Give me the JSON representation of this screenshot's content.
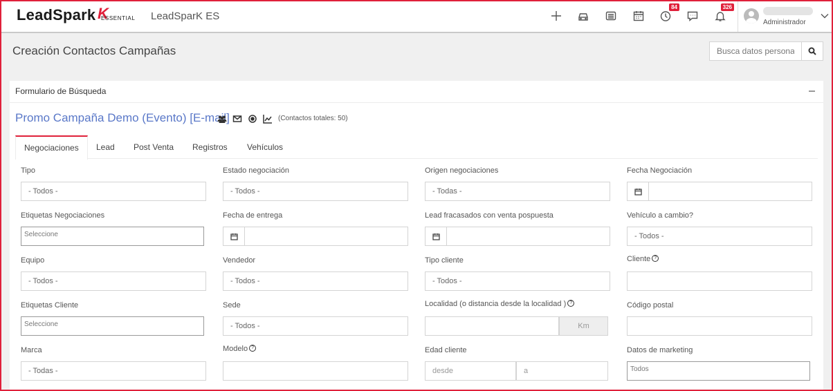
{
  "header": {
    "logo_text": "LeadSpark",
    "logo_sub": "ESSENTIAL",
    "app_name": "LeadSparK ES",
    "icons": [
      "plus-icon",
      "car-icon",
      "inbox-icon",
      "calendar-icon",
      "clock-icon",
      "chat-icon",
      "bell-icon"
    ],
    "clock_badge": "84",
    "bell_badge": "326",
    "user_role": "Administrador"
  },
  "page": {
    "title": "Creación Contactos Campañas",
    "search_placeholder": "Busca datos personale"
  },
  "panel": {
    "title": "Formulario de Búsqueda",
    "campaign_name": "Promo Campaña Demo (Evento) [E-mail]",
    "campaign_icons": [
      "users-icon",
      "envelope-icon",
      "target-icon",
      "chart-line-icon"
    ],
    "contacts_total": "(Contactos totales: 50)"
  },
  "tabs": [
    "Negociaciones",
    "Lead",
    "Post Venta",
    "Registros",
    "Vehículos"
  ],
  "form": {
    "tipo": {
      "label": "Tipo",
      "value": "- Todos -"
    },
    "estado": {
      "label": "Estado negociación",
      "value": "- Todos -"
    },
    "origen": {
      "label": "Origen negociaciones",
      "value": "- Todas -"
    },
    "fecha_neg": {
      "label": "Fecha Negociación",
      "value": ""
    },
    "etiquetas_neg": {
      "label": "Etiquetas Negociaciones",
      "value": "Seleccione"
    },
    "fecha_entrega": {
      "label": "Fecha de entrega",
      "value": ""
    },
    "lead_fracasados": {
      "label": "Lead fracasados con venta pospuesta",
      "value": ""
    },
    "vehiculo_cambio": {
      "label": "Vehículo a cambio?",
      "value": "- Todos -"
    },
    "equipo": {
      "label": "Equipo",
      "value": "- Todos -"
    },
    "vendedor": {
      "label": "Vendedor",
      "value": "- Todos -"
    },
    "tipo_cliente": {
      "label": "Tipo cliente",
      "value": "- Todos -"
    },
    "cliente": {
      "label": "Cliente",
      "value": ""
    },
    "etiquetas_cliente": {
      "label": "Etiquetas Cliente",
      "value": "Seleccione"
    },
    "sede": {
      "label": "Sede",
      "value": "- Todos -"
    },
    "localidad": {
      "label": "Localidad (o distancia desde la localidad )",
      "value": "",
      "addon": "Km"
    },
    "codigo_postal": {
      "label": "Código postal",
      "value": ""
    },
    "marca": {
      "label": "Marca",
      "value": "- Todas -"
    },
    "modelo": {
      "label": "Modelo",
      "value": ""
    },
    "edad": {
      "label": "Edad cliente",
      "from_placeholder": "desde",
      "to_placeholder": "a"
    },
    "marketing": {
      "label": "Datos de marketing",
      "value": "Todos"
    }
  }
}
